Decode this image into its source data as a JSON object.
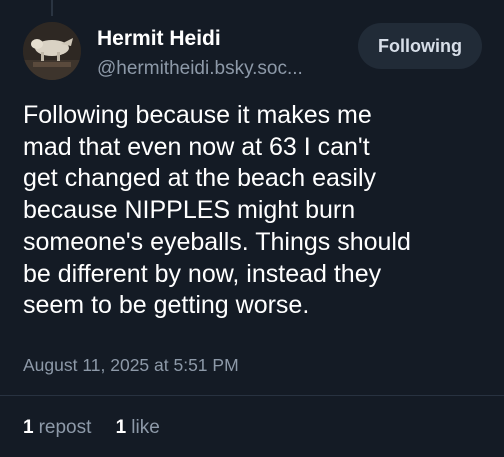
{
  "author": {
    "display_name": "Hermit Heidi",
    "handle": "@hermitheidi.bsky.soc..."
  },
  "follow_button": {
    "label": "Following"
  },
  "post": {
    "lines": [
      "Following because it makes me",
      "mad that even now at 63 I can't",
      "get changed at the beach easily",
      "because NIPPLES might burn",
      "someone's eyeballs. Things should",
      "be different by now, instead they",
      "seem to be getting worse."
    ],
    "timestamp": "August 11, 2025 at 5:51 PM"
  },
  "stats": {
    "reposts": {
      "count": "1",
      "label": "repost"
    },
    "likes": {
      "count": "1",
      "label": "like"
    }
  },
  "colors": {
    "background": "#141b25",
    "secondary_text": "#8d99a8",
    "button_bg": "#212b37"
  }
}
